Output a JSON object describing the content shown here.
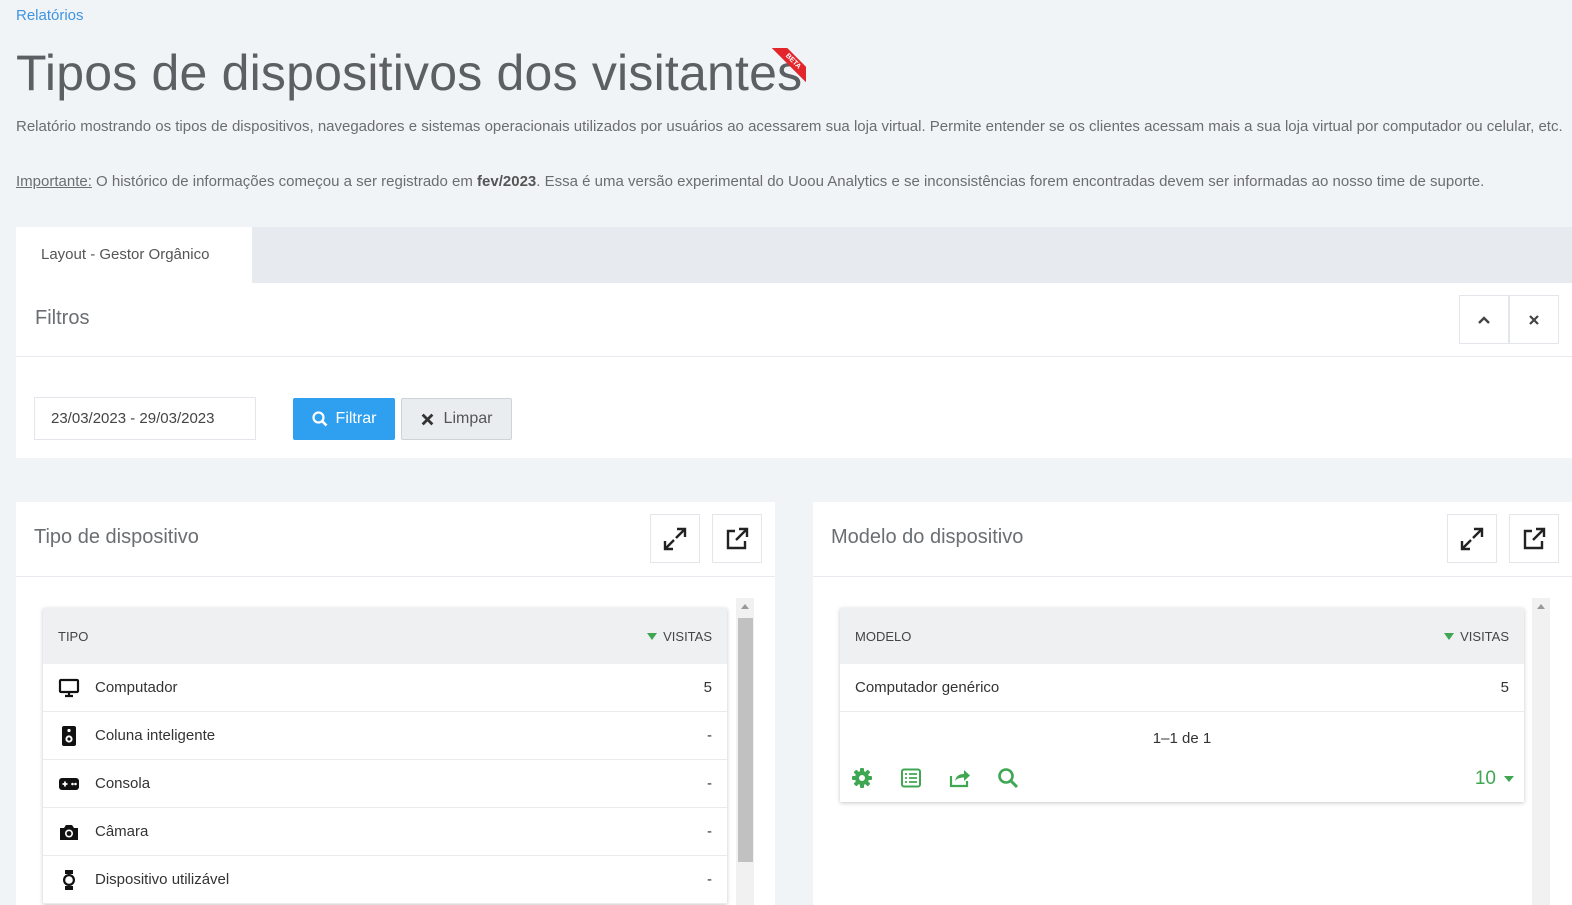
{
  "breadcrumb": "Relatórios",
  "page_title": "Tipos de dispositivos dos visitantes",
  "beta_badge": "BETA",
  "description": "Relatório mostrando os tipos de dispositivos, navegadores e sistemas operacionais utilizados por usuários ao acessarem sua loja virtual. Permite entender se os clientes acessam mais a sua loja virtual por computador ou celular, etc.",
  "notice": {
    "label": "Importante:",
    "text_before": " O histórico de informações começou a ser registrado em ",
    "highlight": "fev/2023",
    "text_after": ". Essa é uma versão experimental do Uoou Analytics e se inconsistências forem encontradas devem ser informadas ao nosso time de suporte."
  },
  "tabs": [
    {
      "label": "Layout - Gestor Orgânico",
      "active": true
    }
  ],
  "filters": {
    "title": "Filtros",
    "date_range": "23/03/2023 - 29/03/2023",
    "filter_button": "Filtrar",
    "clear_button": "Limpar"
  },
  "device_type_card": {
    "title": "Tipo de dispositivo",
    "columns": [
      "TIPO",
      "VISITAS"
    ],
    "rows": [
      {
        "icon": "monitor-icon",
        "label": "Computador",
        "value": "5"
      },
      {
        "icon": "speaker-icon",
        "label": "Coluna inteligente",
        "value": "-"
      },
      {
        "icon": "gamepad-icon",
        "label": "Consola",
        "value": "-"
      },
      {
        "icon": "camera-icon",
        "label": "Câmara",
        "value": "-"
      },
      {
        "icon": "watch-icon",
        "label": "Dispositivo utilizável",
        "value": "-"
      }
    ]
  },
  "device_model_card": {
    "title": "Modelo do dispositivo",
    "columns": [
      "MODELO",
      "VISITAS"
    ],
    "rows": [
      {
        "label": "Computador genérico",
        "value": "5"
      }
    ],
    "pagination": "1–1 de 1",
    "rows_per_page": "10"
  },
  "colors": {
    "accent_blue": "#2f9ff0",
    "accent_green": "#3fa752",
    "beta_red": "#e3262b"
  }
}
